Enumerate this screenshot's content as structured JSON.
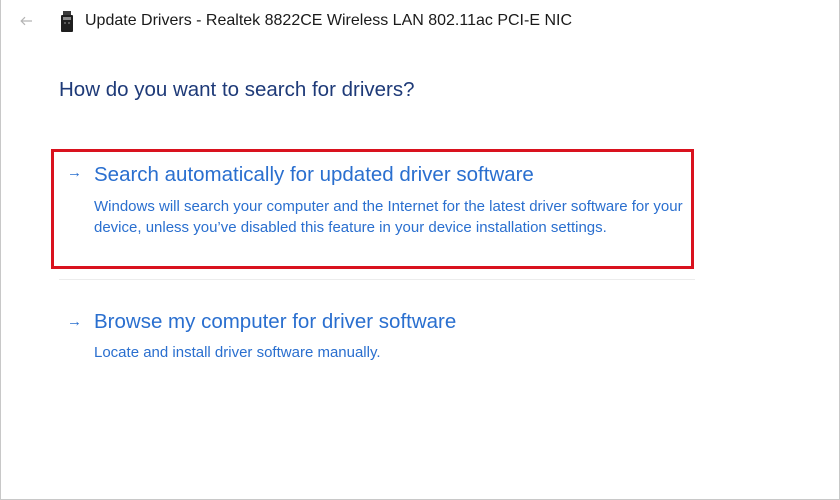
{
  "window": {
    "title": "Update Drivers - Realtek 8822CE Wireless LAN 802.11ac PCI-E NIC",
    "back_icon": "back-arrow-icon",
    "device_icon": "network-adapter-icon"
  },
  "heading": "How do you want to search for drivers?",
  "options": [
    {
      "arrow": "→",
      "title": "Search automatically for updated driver software",
      "description": "Windows will search your computer and the Internet for the latest driver software for your device, unless you’ve disabled this feature in your device installation settings.",
      "highlighted": true
    },
    {
      "arrow": "→",
      "title": "Browse my computer for driver software",
      "description": "Locate and install driver software manually.",
      "highlighted": false
    }
  ],
  "colors": {
    "heading": "#1e3a78",
    "link": "#2a6fcf",
    "highlight_border": "#d9121e"
  }
}
